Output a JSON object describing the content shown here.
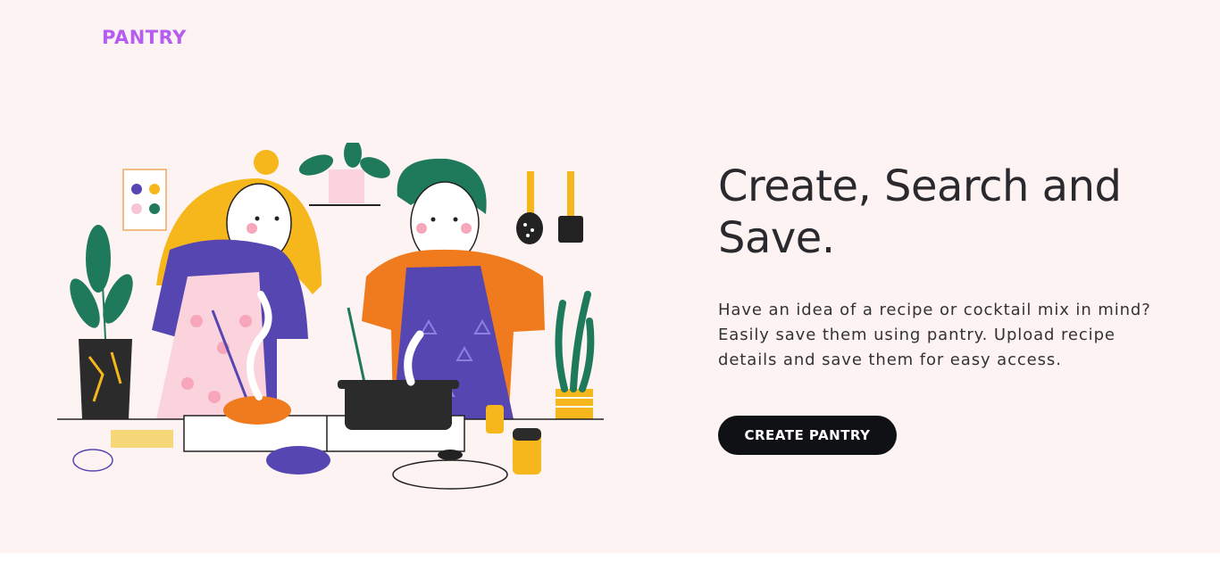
{
  "brand": {
    "logo_text": "PANTRY",
    "color": "#b65cf0"
  },
  "hero": {
    "headline": "Create, Search and Save.",
    "description": "Have an idea of a recipe or cocktail mix in mind? Easily save them using pantry. Upload recipe details and save them for easy access.",
    "cta_label": "CREATE PANTRY",
    "background": "#fdf3f2"
  },
  "illustration": {
    "subject": "two people cooking at a stove"
  },
  "colors": {
    "accent_orange": "#f07a1e",
    "apron_purple": "#5546b2",
    "plant_green": "#1f7a5c",
    "hair_yellow": "#f6b71c",
    "button_dark": "#0f1115"
  }
}
